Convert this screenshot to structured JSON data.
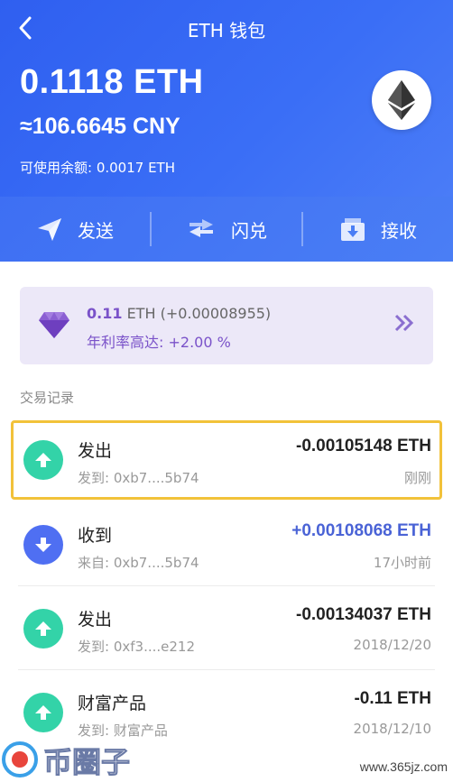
{
  "header": {
    "title": "ETH 钱包",
    "balance": "0.1118 ETH",
    "cny": "≈106.6645 CNY",
    "available_label": "可使用余额: 0.0017 ETH",
    "gradient_start": "#2f5ff0",
    "gradient_end": "#4a7cf7"
  },
  "actions": [
    {
      "label": "发送",
      "icon": "send-icon"
    },
    {
      "label": "闪兑",
      "icon": "swap-icon"
    },
    {
      "label": "接收",
      "icon": "receive-icon"
    }
  ],
  "promo": {
    "amount": "0.11",
    "amount_detail": " ETH (+0.00008955)",
    "rate": "年利率高达: +2.00 %",
    "accent": "#7a52c9"
  },
  "section_title": "交易记录",
  "transactions": [
    {
      "type": "发出",
      "addr": "发到: 0xb7....5b74",
      "amount": "-0.00105148 ETH",
      "time": "刚刚",
      "direction": "out"
    },
    {
      "type": "收到",
      "addr": "来自: 0xb7....5b74",
      "amount": "+0.00108068 ETH",
      "time": "17小时前",
      "direction": "in"
    },
    {
      "type": "发出",
      "addr": "发到: 0xf3....e212",
      "amount": "-0.00134037 ETH",
      "time": "2018/12/20",
      "direction": "out"
    },
    {
      "type": "财富产品",
      "addr": "发到: 财富产品",
      "amount": "-0.11 ETH",
      "time": "2018/12/10",
      "direction": "out"
    }
  ],
  "watermark": {
    "left_text": "币圈子",
    "right_text": "www.365jz.com"
  }
}
